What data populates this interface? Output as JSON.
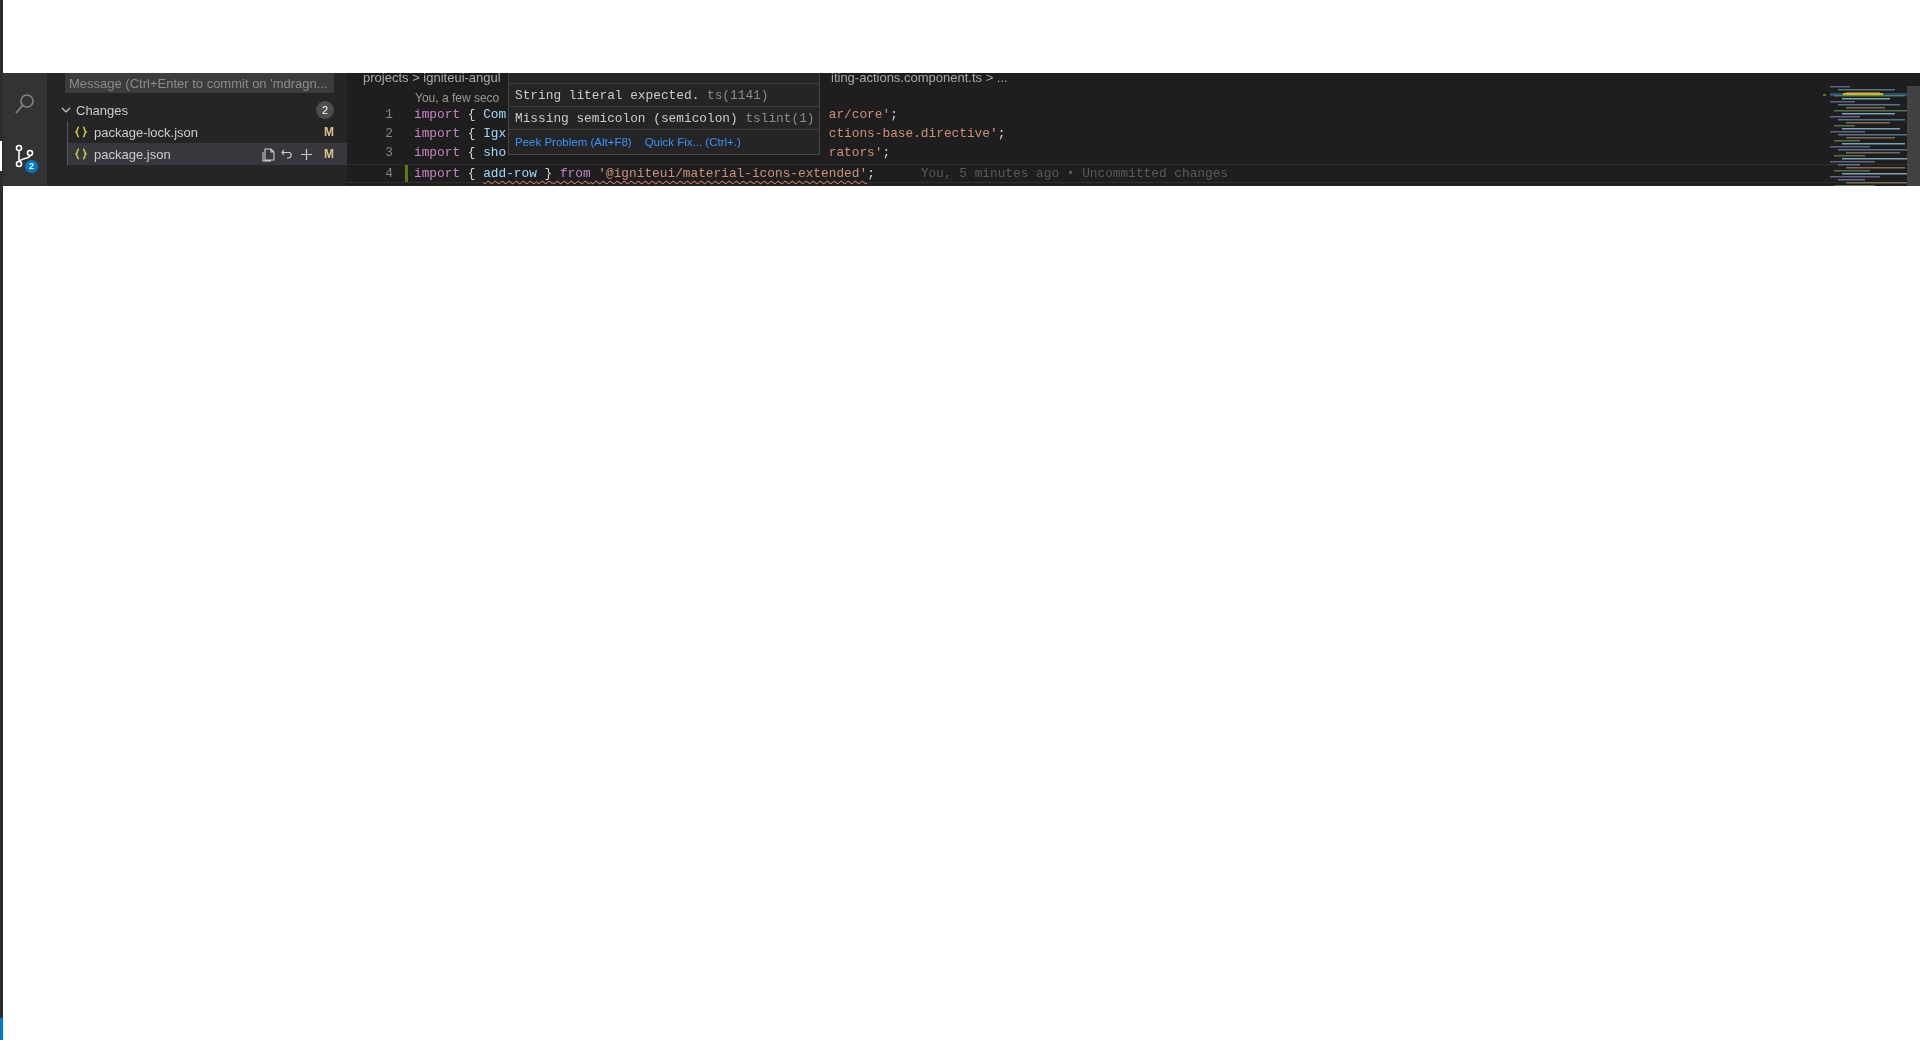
{
  "activity_bar": {
    "items": [
      {
        "kind": "search",
        "selected": false
      },
      {
        "kind": "source-control",
        "selected": true,
        "badge": "2"
      }
    ]
  },
  "source_control": {
    "message_input": {
      "placeholder": "Message (Ctrl+Enter to commit on 'mdragn..."
    },
    "section": {
      "title": "Changes",
      "expanded": true,
      "count": "2"
    },
    "files": [
      {
        "name": "package-lock.json",
        "status": "M",
        "selected": false
      },
      {
        "name": "package.json",
        "status": "M",
        "selected": true
      }
    ]
  },
  "breadcrumb": {
    "left": "projects > igniteui-angul",
    "right": "iting-actions.component.ts > ..."
  },
  "editor": {
    "codelens": "You, a few seco",
    "lines": [
      {
        "number": "1",
        "current": false,
        "modified": false,
        "left": [
          {
            "text": "import",
            "kind": "keyword",
            "error": false
          },
          {
            "text": " { ",
            "kind": "punct",
            "error": false
          },
          {
            "text": "Com",
            "kind": "ident",
            "error": false
          }
        ],
        "right": [
          {
            "text": "ar/core'",
            "kind": "string",
            "error": false
          },
          {
            "text": ";",
            "kind": "punct",
            "error": false
          }
        ]
      },
      {
        "number": "2",
        "current": false,
        "modified": false,
        "left": [
          {
            "text": "import",
            "kind": "keyword",
            "error": false
          },
          {
            "text": " { ",
            "kind": "punct",
            "error": false
          },
          {
            "text": "Igx",
            "kind": "ident",
            "error": false
          }
        ],
        "right": [
          {
            "text": "ctions-base.directive'",
            "kind": "string",
            "error": false
          },
          {
            "text": ";",
            "kind": "punct",
            "error": false
          }
        ]
      },
      {
        "number": "3",
        "current": false,
        "modified": false,
        "left": [
          {
            "text": "import",
            "kind": "keyword",
            "error": false
          },
          {
            "text": " { ",
            "kind": "punct",
            "error": false
          },
          {
            "text": "sho",
            "kind": "ident",
            "error": false
          }
        ],
        "right": [
          {
            "text": "rators'",
            "kind": "string",
            "error": false
          },
          {
            "text": ";",
            "kind": "punct",
            "error": false
          }
        ]
      },
      {
        "number": "4",
        "current": true,
        "modified": true,
        "blame": "You, 5 minutes ago • Uncommitted changes",
        "left": [
          {
            "text": "import",
            "kind": "keyword",
            "error": false
          },
          {
            "text": " { ",
            "kind": "punct",
            "error": false
          },
          {
            "text": "add-row",
            "kind": "ident",
            "error": true
          },
          {
            "text": " }",
            "kind": "punct",
            "error": true
          },
          {
            "text": " from",
            "kind": "keyword",
            "error": true
          },
          {
            "text": " '@igniteui/material-icons-extended'",
            "kind": "string",
            "error": true
          },
          {
            "text": ";",
            "kind": "punct",
            "error": false
          }
        ]
      }
    ]
  },
  "hover": {
    "messages": [
      {
        "text": "String literal expected.",
        "source": "ts(1141)"
      },
      {
        "text": "Missing semicolon (semicolon)",
        "source": "tslint(1)"
      }
    ],
    "actions": [
      "Peek Problem (Alt+F8)",
      "Quick Fix... (Ctrl+.)"
    ]
  }
}
